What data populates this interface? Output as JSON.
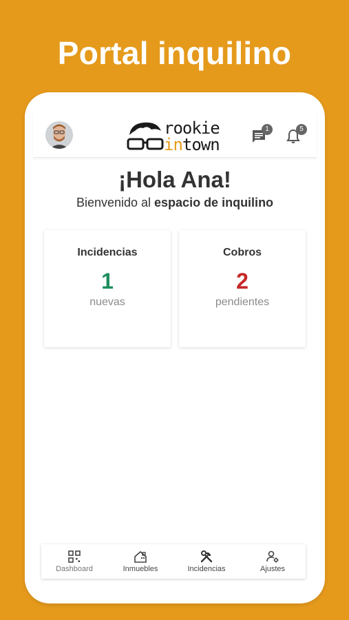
{
  "promo": {
    "title": "Portal inquilino"
  },
  "header": {
    "logo_text_top": "rookie",
    "logo_text_bottom_accent": "in",
    "logo_text_bottom": "town",
    "messages_badge": "1",
    "notifications_badge": "5"
  },
  "welcome": {
    "greeting": "¡Hola Ana!",
    "subtitle_prefix": "Bienvenido al ",
    "subtitle_bold": "espacio de inquilino"
  },
  "cards": [
    {
      "title": "Incidencias",
      "count": "1",
      "label": "nuevas",
      "color": "#1E8E5E"
    },
    {
      "title": "Cobros",
      "count": "2",
      "label": "pendientes",
      "color": "#C62828"
    }
  ],
  "nav": {
    "items": [
      {
        "label": "Dashboard",
        "icon": "dashboard-icon"
      },
      {
        "label": "Inmuebles",
        "icon": "house-icon"
      },
      {
        "label": "Incidencias",
        "icon": "tools-icon"
      },
      {
        "label": "Ajustes",
        "icon": "user-settings-icon"
      }
    ]
  },
  "colors": {
    "brand": "#E59A1C",
    "success": "#1E8E5E",
    "danger": "#C62828"
  }
}
